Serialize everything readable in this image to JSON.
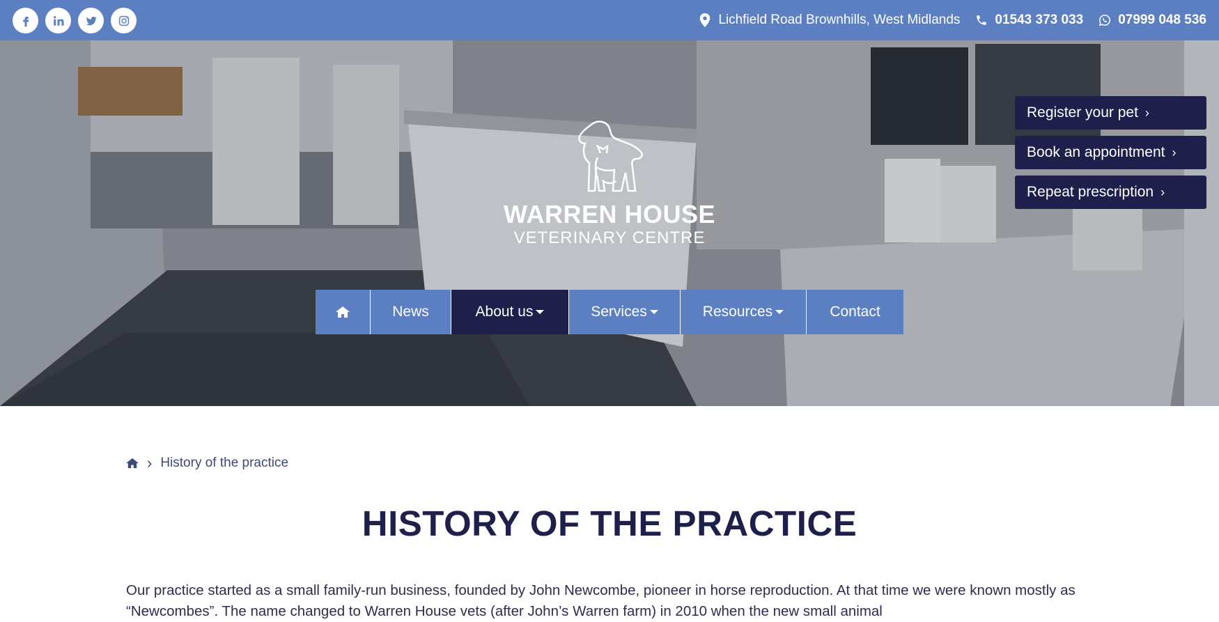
{
  "topbar": {
    "social": [
      {
        "name": "facebook-icon"
      },
      {
        "name": "linkedin-icon"
      },
      {
        "name": "twitter-icon"
      },
      {
        "name": "instagram-icon"
      }
    ],
    "address": "Lichfield Road Brownhills, West Midlands",
    "phone": "01543 373 033",
    "mobile": "07999 048 536",
    "color": "#5b7fc0"
  },
  "hero": {
    "logo_title": "WARREN HOUSE",
    "logo_subtitle": "VETERINARY CENTRE",
    "cta": [
      {
        "label": "Register your pet"
      },
      {
        "label": "Book an appointment"
      },
      {
        "label": "Repeat prescription"
      }
    ],
    "nav": [
      {
        "label": "News"
      },
      {
        "label": "About us"
      },
      {
        "label": "Services"
      },
      {
        "label": "Resources"
      },
      {
        "label": "Contact"
      }
    ],
    "active_nav": "About us",
    "accent": "#1e1f4a"
  },
  "breadcrumb": {
    "current": "History of the practice"
  },
  "main": {
    "title": "HISTORY OF THE PRACTICE",
    "intro": "Our practice started as a small family-run business, founded by John Newcombe, pioneer in horse reproduction. At that time we were known mostly as “Newcombes”. The name changed to Warren House vets (after John’s Warren farm) in 2010 when the new small animal"
  }
}
